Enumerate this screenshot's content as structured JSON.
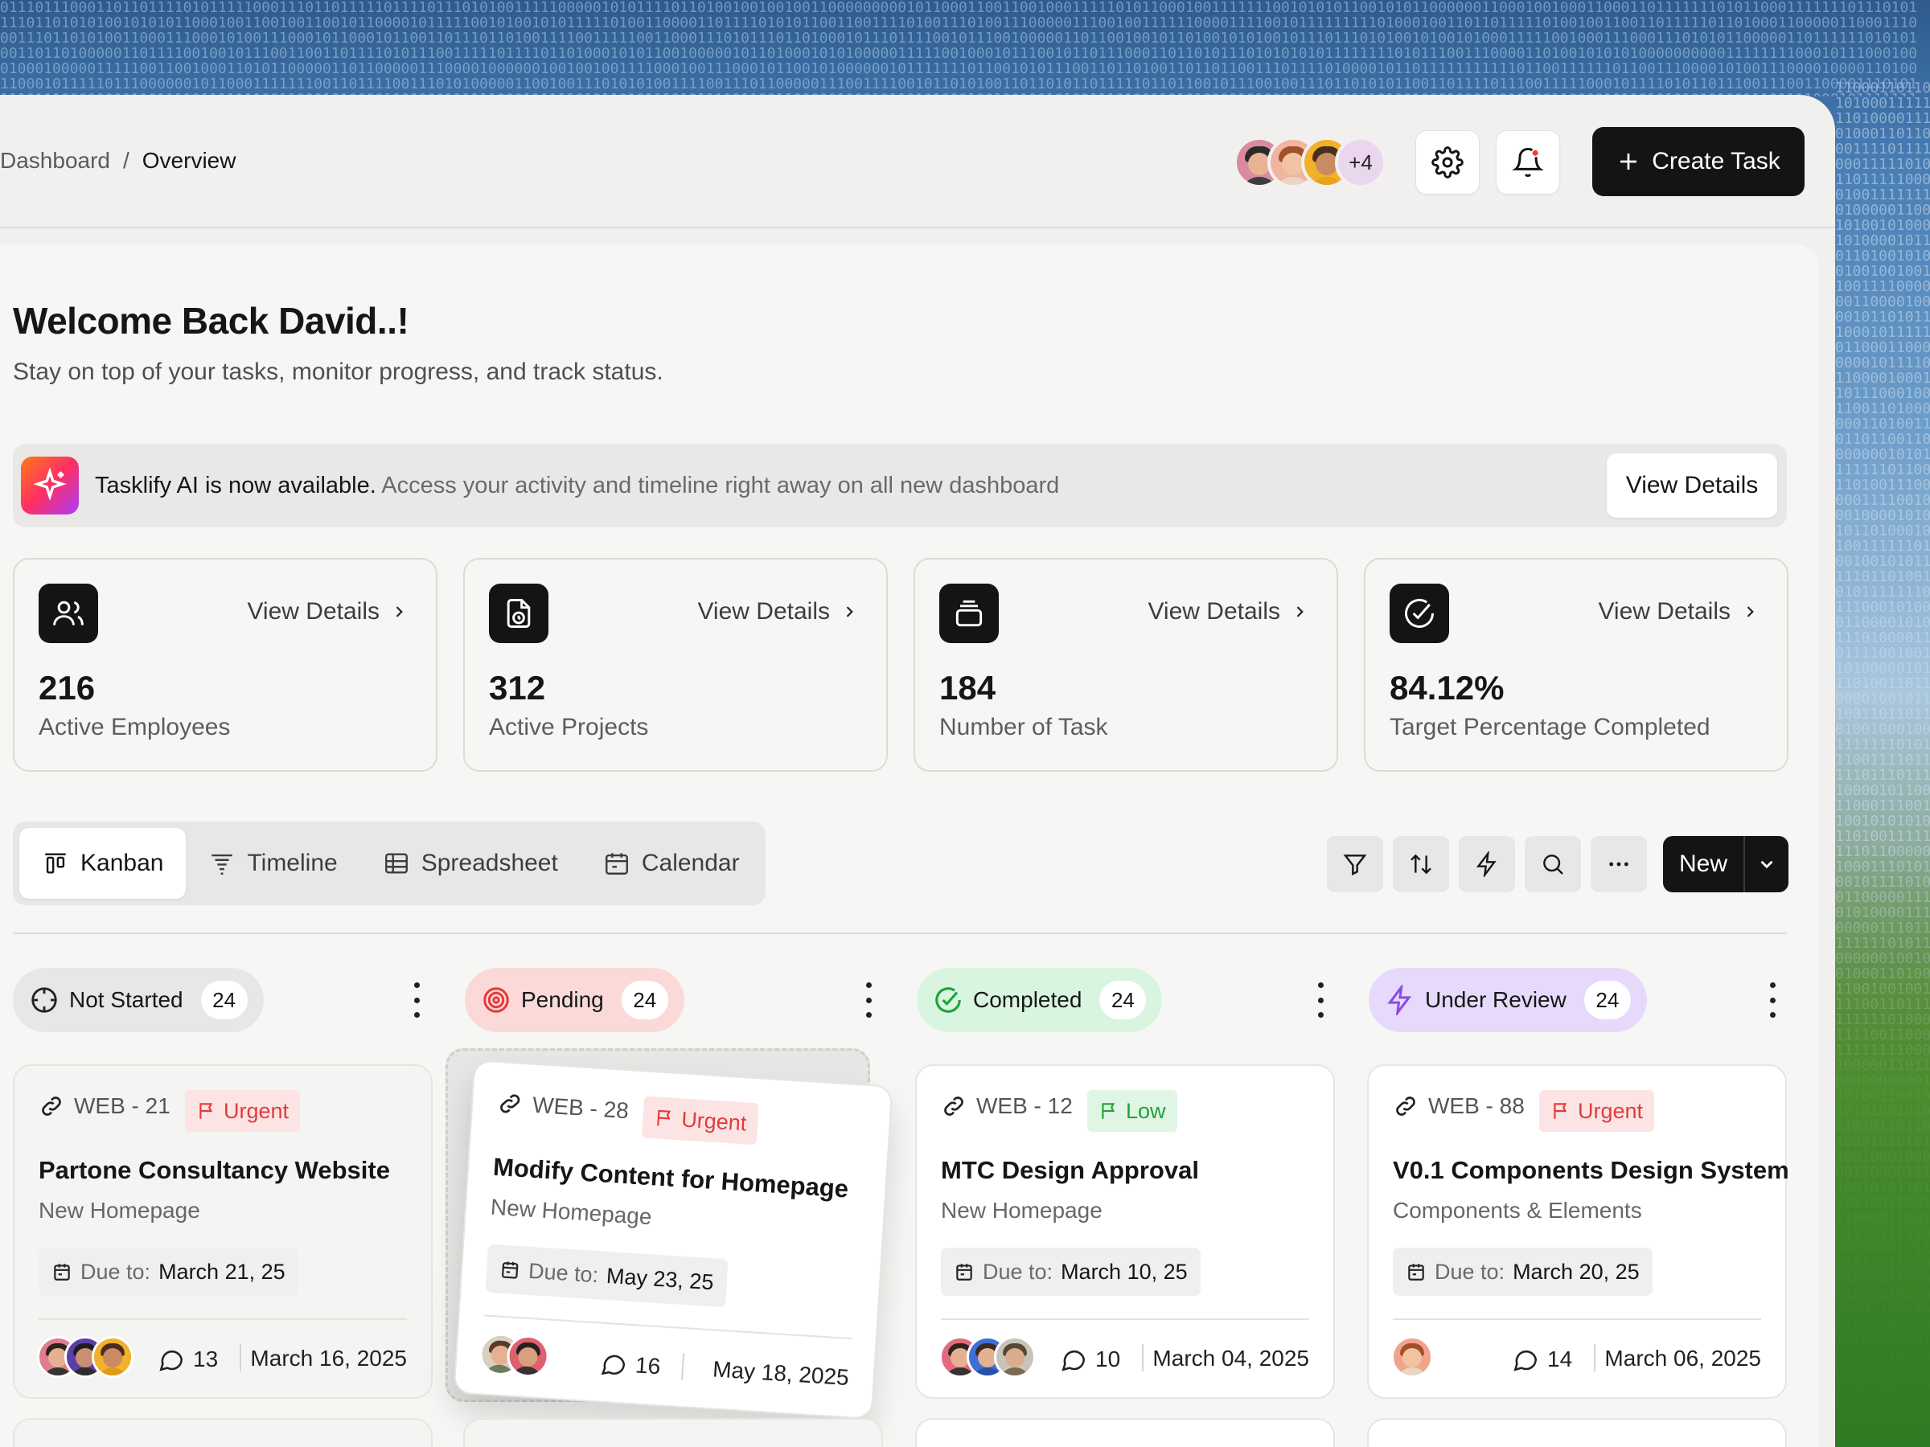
{
  "colors": {
    "accent": "#141414",
    "urgent": "#e23b3b",
    "low": "#1fa33b",
    "pending_bg": "#fcd9d9",
    "completed_bg": "#d9f5df",
    "review_bg": "#e6d9fb",
    "notstarted_bg": "#e8e7e5"
  },
  "breadcrumb": {
    "parent": "Dashboard",
    "separator": "/",
    "current": "Overview"
  },
  "header": {
    "avatar_overflow": "+4",
    "settings_icon": "gear-icon",
    "notification_icon": "bell-icon",
    "create_label": "Create Task"
  },
  "welcome": {
    "title": "Welcome Back David..!",
    "subtitle": "Stay on top of your tasks, monitor progress, and track status."
  },
  "banner": {
    "strong": "Tasklify AI is now available.",
    "text": " Access your activity and timeline right away on all new dashboard",
    "button": "View Details"
  },
  "stats": [
    {
      "icon": "users-icon",
      "link": "View Details",
      "value": "216",
      "label": "Active Employees"
    },
    {
      "icon": "file-clock-icon",
      "link": "View Details",
      "value": "312",
      "label": "Active Projects"
    },
    {
      "icon": "stack-icon",
      "link": "View Details",
      "value": "184",
      "label": "Number of Task"
    },
    {
      "icon": "check-circle-icon",
      "link": "View Details",
      "value": "84.12%",
      "label": "Target Percentage Completed"
    }
  ],
  "views": {
    "tabs": [
      {
        "label": "Kanban",
        "active": true
      },
      {
        "label": "Timeline"
      },
      {
        "label": "Spreadsheet"
      },
      {
        "label": "Calendar"
      }
    ]
  },
  "toolbar": {
    "tools": [
      "filter-icon",
      "sort-icon",
      "bolt-icon",
      "search-icon",
      "more-icon"
    ],
    "new_label": "New"
  },
  "columns": [
    {
      "name": "Not Started",
      "count": "24"
    },
    {
      "name": "Pending",
      "count": "24"
    },
    {
      "name": "Completed",
      "count": "24"
    },
    {
      "name": "Under Review",
      "count": "24"
    }
  ],
  "cards": [
    {
      "id": "WEB - 21",
      "priority": "Urgent",
      "title": "Partone Consultancy Website",
      "subtitle": "New Homepage",
      "due_label": "Due to:",
      "due": "March 21, 25",
      "comments": "13",
      "date": "March 16, 2025"
    },
    {
      "id": "WEB - 28",
      "priority": "Urgent",
      "title": "Modify Content for Homepage",
      "subtitle": "New Homepage",
      "due_label": "Due to:",
      "due": "May 23, 25",
      "comments": "16",
      "date": "May 18, 2025"
    },
    {
      "id": "WEB - 12",
      "priority": "Low",
      "title": "MTC Design Approval",
      "subtitle": "New Homepage",
      "due_label": "Due to:",
      "due": "March 10, 25",
      "comments": "10",
      "date": "March 04, 2025"
    },
    {
      "id": "WEB - 88",
      "priority": "Urgent",
      "title": "V0.1 Components Design System",
      "subtitle": "Components & Elements",
      "due_label": "Due to:",
      "due": "March 20, 25",
      "comments": "14",
      "date": "March 06, 2025"
    }
  ]
}
